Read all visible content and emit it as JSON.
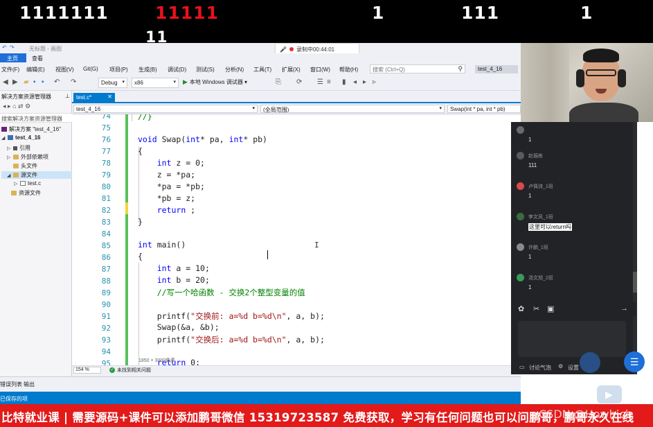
{
  "danmaku": [
    {
      "text": "1111111",
      "color": "#ffffff"
    },
    {
      "text": "11111",
      "color": "#e8121c"
    },
    {
      "text": "1",
      "color": "#ffffff"
    },
    {
      "text": "111",
      "color": "#ffffff"
    },
    {
      "text": "1",
      "color": "#ffffff"
    },
    {
      "text": "11",
      "color": "#ffffff"
    }
  ],
  "titlebar": {
    "text": "无标题 - 画图",
    "recording": "录制中00:44:01"
  },
  "ribbon_tabs": [
    "主页",
    "查看"
  ],
  "menu": [
    "文件(F)",
    "编辑(E)",
    "视图(V)",
    "Git(G)",
    "项目(P)",
    "生成(B)",
    "调试(D)",
    "测试(S)",
    "分析(N)",
    "工具(T)",
    "扩展(X)",
    "窗口(W)",
    "帮助(H)"
  ],
  "search": {
    "placeholder": "搜索 (Ctrl+Q)"
  },
  "project_title": "test_4_16",
  "toolbar": {
    "config": "Debug",
    "platform": "x86",
    "run_label": "本地 Windows 调试器"
  },
  "solution_explorer": {
    "title": "解决方案资源管理器",
    "search_placeholder": "搜索解决方案资源管理器",
    "items": [
      {
        "label": "解决方案 \"test_4_16\"",
        "icon": "solution-icon"
      },
      {
        "label": "test_4_16",
        "icon": "project-icon"
      },
      {
        "label": "引用",
        "icon": "reference-icon"
      },
      {
        "label": "外部依赖项",
        "icon": "folder-icon"
      },
      {
        "label": "头文件",
        "icon": "folder-icon"
      },
      {
        "label": "源文件",
        "icon": "folder-icon"
      },
      {
        "label": "test.c",
        "icon": "file-icon"
      },
      {
        "label": "资源文件",
        "icon": "folder-icon"
      }
    ]
  },
  "editor": {
    "tab": "test.c*",
    "nav_project": "test_4_16",
    "nav_scope": "(全局范围)",
    "nav_function": "Swap(int * pa, int * pb)",
    "zoom": "154 %",
    "issues": "未找到相关问题",
    "line_numbers": [
      "74",
      "75",
      "76",
      "77",
      "78",
      "79",
      "80",
      "81",
      "82",
      "83",
      "84",
      "85",
      "86",
      "87",
      "88",
      "89",
      "90",
      "91",
      "92",
      "93",
      "94",
      "95"
    ]
  },
  "bottom_tabs": [
    "错误列表",
    "输出"
  ],
  "status": {
    "saved": "已保存的项",
    "image_info": "1850 × 3000像素",
    "add_to_list": "添加到"
  },
  "chat": {
    "messages": [
      {
        "user": "",
        "text": "1",
        "avatar_color": "#6b6b6b"
      },
      {
        "user": "赵振栋",
        "text": "111",
        "avatar_color": "#5a5a5a"
      },
      {
        "user": "卢佩诗_1班",
        "text": "1",
        "avatar_color": "#d84a4a"
      },
      {
        "user": "李文凤_1班",
        "text": "这里可以return吗",
        "avatar_color": "#3d6b3d"
      },
      {
        "user": "许鹏_1班",
        "text": "1",
        "avatar_color": "#8a8a8a"
      },
      {
        "user": "汤文旭_2班",
        "text": "1",
        "avatar_color": "#3a9a5a"
      }
    ],
    "footer_discuss": "讨论气泡",
    "footer_settings": "设置"
  },
  "banner": "比特就业课 | 需要源码+课件可以添加鹏哥微信 15319723587 免费获取，学习有任何问题也可以问鹏哥，鹏哥永久在线",
  "watermark": "CSDN @Howhich"
}
